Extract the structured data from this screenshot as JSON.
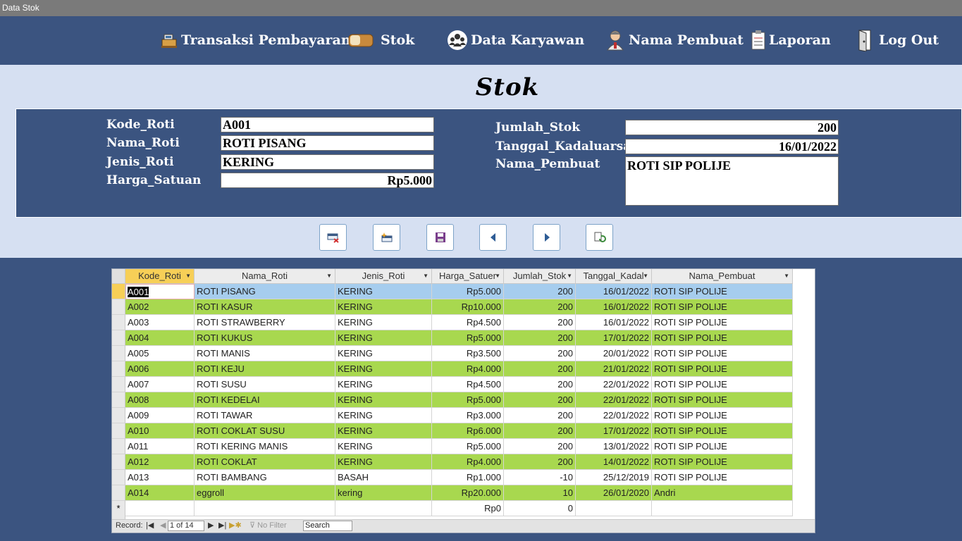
{
  "window": {
    "title": "Data Stok"
  },
  "nav": [
    {
      "label": "Transaksi Pembayaran",
      "icon": "cash-register-icon",
      "name": "transaksi-pembayaran"
    },
    {
      "label": "Stok",
      "icon": "bread-icon",
      "name": "stok"
    },
    {
      "label": "Data Karyawan",
      "icon": "group-icon",
      "name": "data-karyawan"
    },
    {
      "label": "Nama Pembuat",
      "icon": "person-icon",
      "name": "nama-pembuat"
    },
    {
      "label": "Laporan",
      "icon": "clipboard-icon",
      "name": "laporan"
    },
    {
      "label": "Log Out",
      "icon": "door-exit-icon",
      "name": "log-out"
    }
  ],
  "page": {
    "title": "Stok"
  },
  "form": {
    "kode_roti": {
      "label": "Kode_Roti",
      "value": "A001"
    },
    "nama_roti": {
      "label": "Nama_Roti",
      "value": "ROTI PISANG"
    },
    "jenis_roti": {
      "label": "Jenis_Roti",
      "value": "KERING"
    },
    "harga_satuan": {
      "label": "Harga_Satuan",
      "value": "Rp5.000"
    },
    "jumlah_stok": {
      "label": "Jumlah_Stok",
      "value": "200"
    },
    "tanggal_kadaluarsa": {
      "label": "Tanggal_Kadaluarsa",
      "value": "16/01/2022"
    },
    "nama_pembuat": {
      "label": "Nama_Pembuat",
      "value": "ROTI SIP POLIJE"
    }
  },
  "buttons": [
    {
      "name": "delete-record-button",
      "icon": "delete-record-icon"
    },
    {
      "name": "new-record-button",
      "icon": "new-record-icon"
    },
    {
      "name": "save-record-button",
      "icon": "save-icon"
    },
    {
      "name": "previous-record-button",
      "icon": "triangle-left-icon"
    },
    {
      "name": "next-record-button",
      "icon": "triangle-right-icon"
    },
    {
      "name": "refresh-button",
      "icon": "refresh-icon"
    }
  ],
  "grid": {
    "columns": [
      "Kode_Roti",
      "Nama_Roti",
      "Jenis_Roti",
      "Harga_Satuer",
      "Jumlah_Stok",
      "Tanggal_Kadal",
      "Nama_Pembuat"
    ],
    "rows": [
      [
        "A001",
        "ROTI PISANG",
        "KERING",
        "Rp5.000",
        "200",
        "16/01/2022",
        "ROTI SIP POLIJE"
      ],
      [
        "A002",
        "ROTI KASUR",
        "KERING",
        "Rp10.000",
        "200",
        "16/01/2022",
        "ROTI SIP POLIJE"
      ],
      [
        "A003",
        "ROTI STRAWBERRY",
        "KERING",
        "Rp4.500",
        "200",
        "16/01/2022",
        "ROTI SIP POLIJE"
      ],
      [
        "A004",
        "ROTI KUKUS",
        "KERING",
        "Rp5.000",
        "200",
        "17/01/2022",
        "ROTI SIP POLIJE"
      ],
      [
        "A005",
        "ROTI MANIS",
        "KERING",
        "Rp3.500",
        "200",
        "20/01/2022",
        "ROTI SIP POLIJE"
      ],
      [
        "A006",
        "ROTI KEJU",
        "KERING",
        "Rp4.000",
        "200",
        "21/01/2022",
        "ROTI SIP POLIJE"
      ],
      [
        "A007",
        "ROTI SUSU",
        "KERING",
        "Rp4.500",
        "200",
        "22/01/2022",
        "ROTI SIP POLIJE"
      ],
      [
        "A008",
        "ROTI KEDELAI",
        "KERING",
        "Rp5.000",
        "200",
        "22/01/2022",
        "ROTI SIP POLIJE"
      ],
      [
        "A009",
        "ROTI TAWAR",
        "KERING",
        "Rp3.000",
        "200",
        "22/01/2022",
        "ROTI SIP POLIJE"
      ],
      [
        "A010",
        "ROTI COKLAT SUSU",
        "KERING",
        "Rp6.000",
        "200",
        "17/01/2022",
        "ROTI SIP POLIJE"
      ],
      [
        "A011",
        "ROTI KERING MANIS",
        "KERING",
        "Rp5.000",
        "200",
        "13/01/2022",
        "ROTI SIP POLIJE"
      ],
      [
        "A012",
        "ROTI COKLAT",
        "KERING",
        "Rp4.000",
        "200",
        "14/01/2022",
        "ROTI SIP POLIJE"
      ],
      [
        "A013",
        "ROTI BAMBANG",
        "BASAH",
        "Rp1.000",
        "-10",
        "25/12/2019",
        "ROTI SIP POLIJE"
      ],
      [
        "A014",
        "eggroll",
        "kering",
        "Rp20.000",
        "10",
        "26/01/2020",
        "Andri"
      ]
    ],
    "new_row": {
      "marker": "*",
      "harga": "Rp0",
      "jumlah": "0"
    }
  },
  "record_nav": {
    "label": "Record:",
    "position": "1 of 14",
    "filter": "No Filter",
    "search": "Search"
  },
  "colors": {
    "bg": "#3b5480",
    "band": "#d6e0f2",
    "row_alt": "#a8d84f",
    "row_selected": "#a6cdee",
    "header_active": "#f7cf57"
  }
}
